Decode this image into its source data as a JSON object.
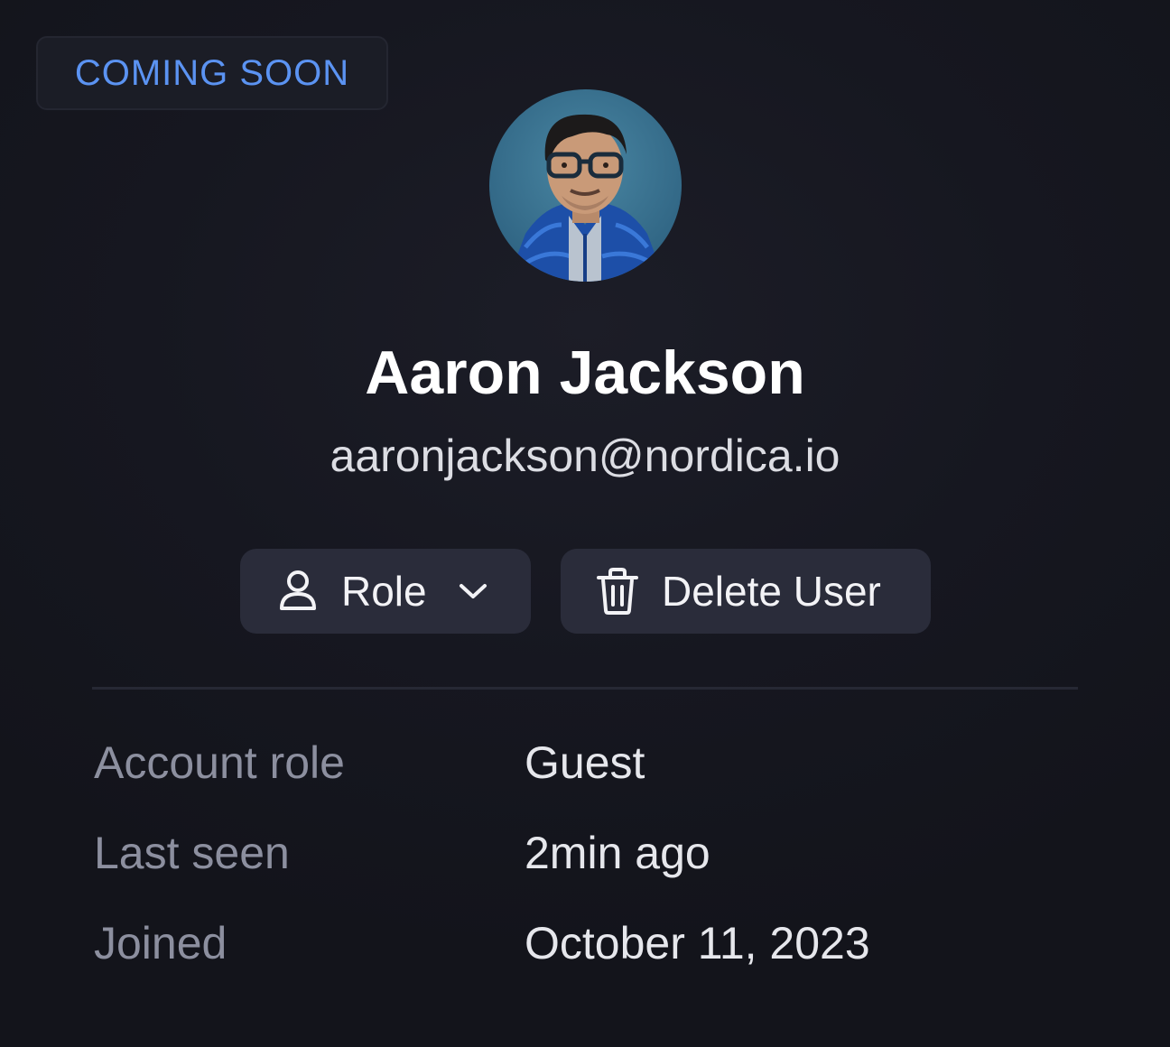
{
  "badge": {
    "label": "COMING SOON"
  },
  "profile": {
    "name": "Aaron Jackson",
    "email": "aaronjackson@nordica.io"
  },
  "actions": {
    "role_label": "Role",
    "delete_label": "Delete User"
  },
  "details": [
    {
      "label": "Account role",
      "value": "Guest"
    },
    {
      "label": "Last seen",
      "value": "2min ago"
    },
    {
      "label": "Joined",
      "value": "October 11, 2023"
    }
  ],
  "colors": {
    "background": "#161720",
    "badge_text": "#5b93f2",
    "button_bg": "#2a2c3a",
    "label_text": "#8c8f9f",
    "value_text": "#e6e7ec"
  },
  "icons": {
    "role_button": "user-icon",
    "role_dropdown": "chevron-down-icon",
    "delete_button": "trash-icon"
  }
}
